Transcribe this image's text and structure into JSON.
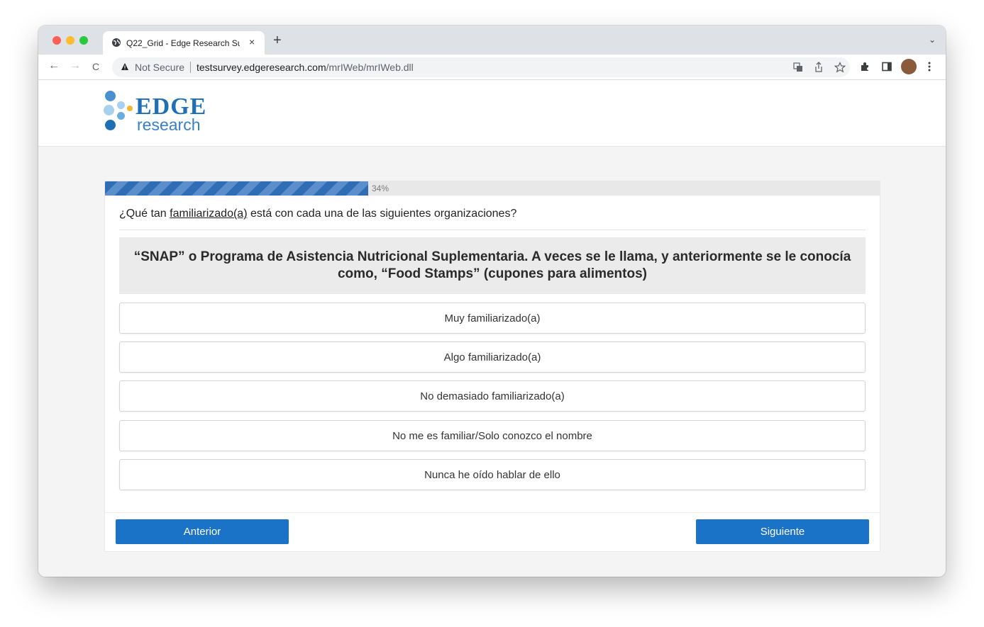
{
  "browser": {
    "tab_title": "Q22_Grid - Edge Research Sur",
    "tab_close": "×",
    "new_tab": "+",
    "tab_menu": "⌄",
    "back": "←",
    "forward": "→",
    "reload": "C",
    "security_warning": "Not Secure",
    "url_domain": "testsurvey.edgeresearch.com",
    "url_path": "/mrIWeb/mrIWeb.dll",
    "icons": [
      "translate-icon",
      "share-icon",
      "star-icon",
      "extensions-icon",
      "sidepanel-icon",
      "profile-avatar",
      "kebab-menu-icon"
    ]
  },
  "brand": {
    "name_line1": "EDGE",
    "name_line2": "research"
  },
  "survey": {
    "progress_percent": 34,
    "progress_label": "34%",
    "question_prefix": "¿Qué tan ",
    "question_underlined": "familiarizado(a)",
    "question_suffix": " está con cada una de las siguientes organizaciones?",
    "item": "“SNAP” o Programa de Asistencia Nutricional Suplementaria. A veces se le llama, y anteriormente se le conocía como, “Food Stamps” (cupones para alimentos)",
    "options": [
      "Muy familiarizado(a)",
      "Algo familiarizado(a)",
      "No demasiado familiarizado(a)",
      "No me es familiar/Solo conozco el nombre",
      "Nunca he oído hablar de ello"
    ],
    "prev_label": "Anterior",
    "next_label": "Siguiente"
  },
  "colors": {
    "primary_button": "#1b73c8",
    "progress_fill": "#2f6db5",
    "logo_blue": "#1f6fb5",
    "logo_accent": "#f2b632"
  }
}
